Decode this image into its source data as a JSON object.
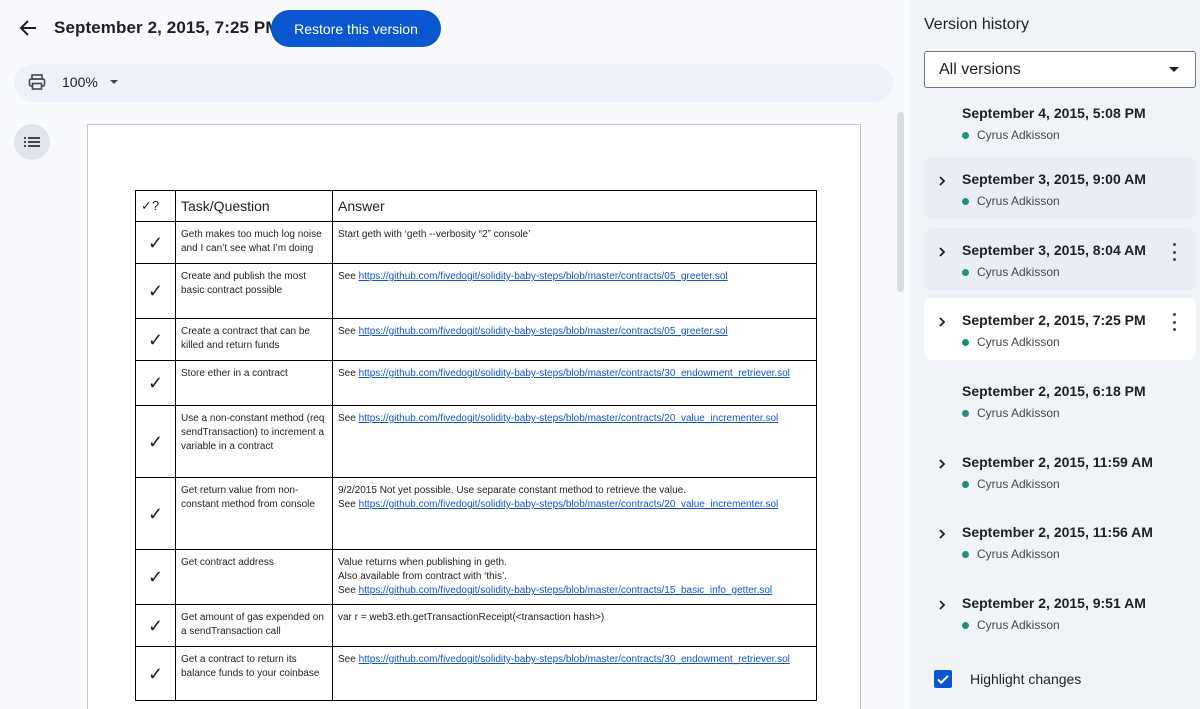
{
  "header": {
    "title": "September 2, 2015, 7:25 PM",
    "restore_label": "Restore this version"
  },
  "toolbar": {
    "zoom": "100%"
  },
  "table": {
    "headers": [
      "✓?",
      "Task/Question",
      "Answer"
    ],
    "rows": [
      {
        "check": "✓",
        "task": "Geth makes too much log noise and I can’t see what I’m doing",
        "answer_lines": [
          "Start geth with ‘geth --verbosity “2” console’"
        ],
        "link": ""
      },
      {
        "check": "✓",
        "task": "Create and publish the most basic contract possible",
        "answer_lines": [],
        "link": "https://github.com/fivedogit/solidity-baby-steps/blob/master/contracts/05_greeter.sol"
      },
      {
        "check": "✓",
        "task": "Create a contract that can be killed and return funds",
        "answer_lines": [],
        "link": "https://github.com/fivedogit/solidity-baby-steps/blob/master/contracts/05_greeter.sol"
      },
      {
        "check": "✓",
        "task": "Store ether in a contract",
        "answer_lines": [],
        "link": "https://github.com/fivedogit/solidity-baby-steps/blob/master/contracts/30_endowment_retriever.sol"
      },
      {
        "check": "✓",
        "task": "Use a non-constant method (req sendTransaction) to increment a variable in a contract",
        "answer_lines": [],
        "link": "https://github.com/fivedogit/solidity-baby-steps/blob/master/contracts/20_value_incrementer.sol"
      },
      {
        "check": "✓",
        "task": "Get return value from non-constant method from console",
        "answer_lines": [
          "9/2/2015 Not yet possible. Use separate constant method to retrieve the value."
        ],
        "link": "https://github.com/fivedogit/solidity-baby-steps/blob/master/contracts/20_value_incrementer.sol"
      },
      {
        "check": "✓",
        "task": "Get contract address",
        "answer_lines": [
          "Value returns when publishing in geth.",
          "Also available from contract with ‘this’."
        ],
        "link": "https://github.com/fivedogit/solidity-baby-steps/blob/master/contracts/15_basic_info_getter.sol"
      },
      {
        "check": "✓",
        "task": "Get amount of gas expended on a sendTransaction call",
        "answer_lines": [
          "var r = web3.eth.getTransactionReceipt(<transaction hash>)"
        ],
        "link": ""
      },
      {
        "check": "✓",
        "task": "Get a contract to return its balance funds to your coinbase",
        "answer_lines": [],
        "link": "https://github.com/fivedogit/solidity-baby-steps/blob/master/contracts/30_endowment_retriever.sol"
      }
    ],
    "see_prefix": "See "
  },
  "sidebar": {
    "title": "Version history",
    "filter": "All versions",
    "versions": [
      {
        "date": "September 4, 2015, 5:08 PM",
        "author": "Cyrus Adkisson"
      },
      {
        "date": "September 3, 2015, 9:00 AM",
        "author": "Cyrus Adkisson"
      },
      {
        "date": "September 3, 2015, 8:04 AM",
        "author": "Cyrus Adkisson"
      },
      {
        "date": "September 2, 2015, 7:25 PM",
        "author": "Cyrus Adkisson"
      },
      {
        "date": "September 2, 2015, 6:18 PM",
        "author": "Cyrus Adkisson"
      },
      {
        "date": "September 2, 2015, 11:59 AM",
        "author": "Cyrus Adkisson"
      },
      {
        "date": "September 2, 2015, 11:56 AM",
        "author": "Cyrus Adkisson"
      },
      {
        "date": "September 2, 2015, 9:51 AM",
        "author": "Cyrus Adkisson"
      }
    ],
    "highlight_label": "Highlight changes",
    "highlight_checked": true
  },
  "colors": {
    "accent": "#0b57d0",
    "author_dot": "#1e8e7e",
    "link": "#1155cc"
  }
}
